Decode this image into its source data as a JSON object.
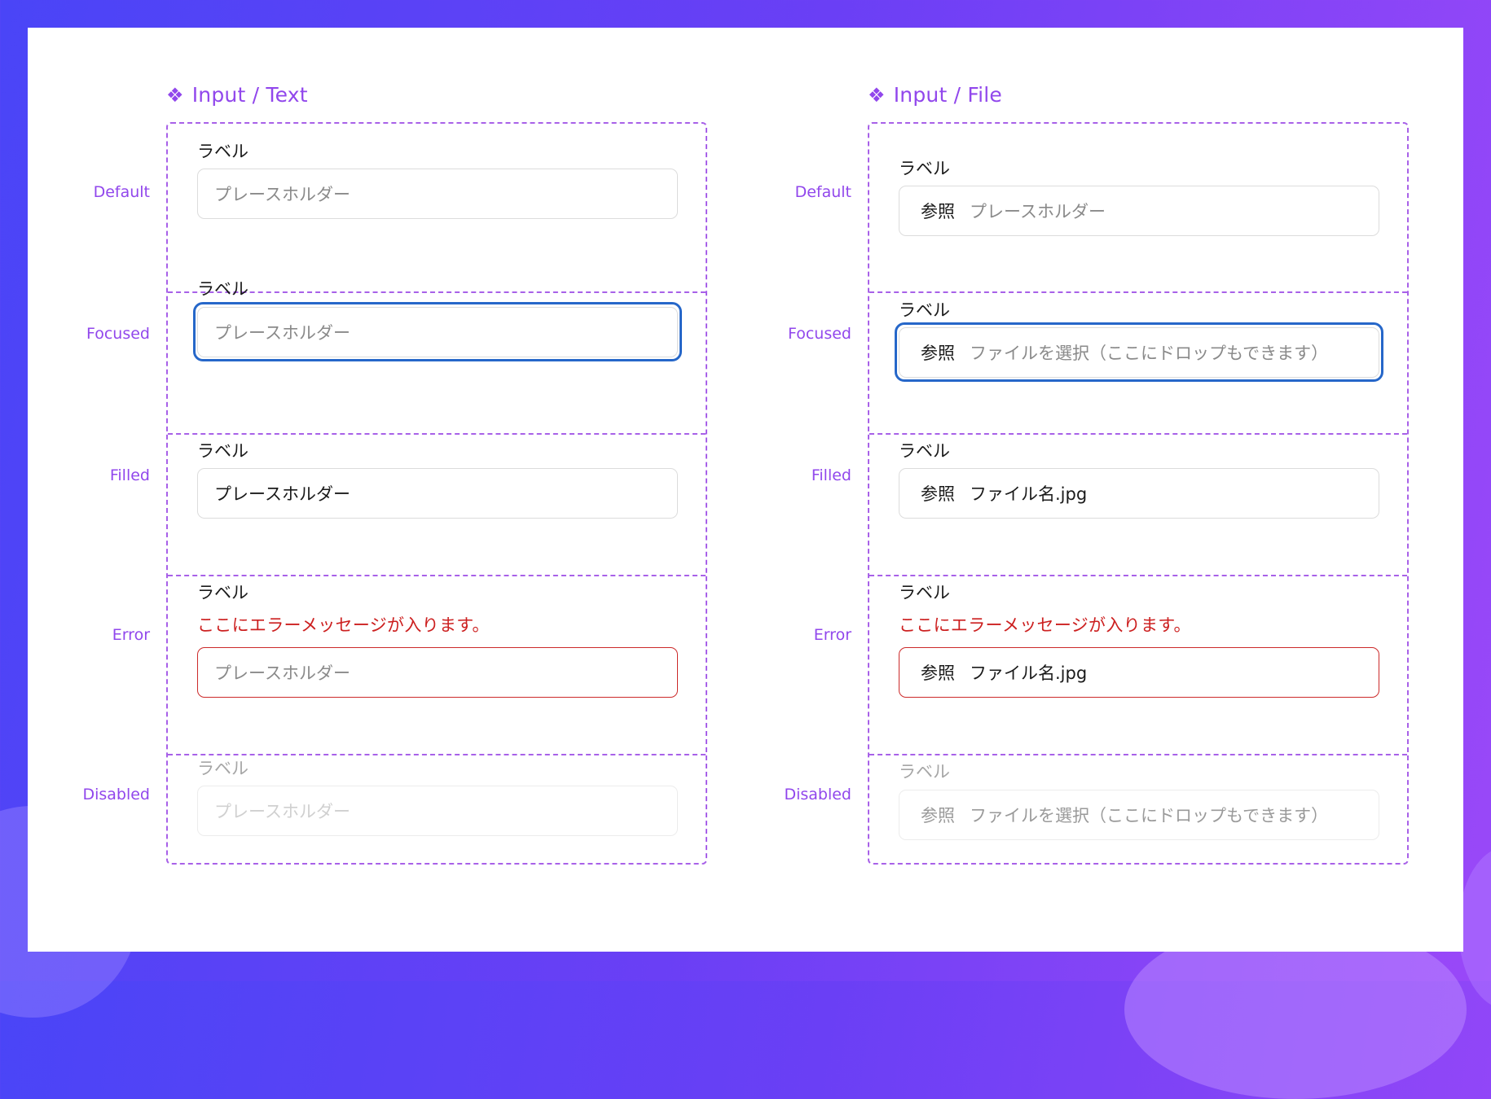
{
  "sections": {
    "text": {
      "title": "Input / Text",
      "icon": "component-icon",
      "states": {
        "default": {
          "state_label": "Default",
          "label": "ラベル",
          "placeholder": "プレースホルダー"
        },
        "focused": {
          "state_label": "Focused",
          "label": "ラベル",
          "placeholder": "プレースホルダー"
        },
        "filled": {
          "state_label": "Filled",
          "label": "ラベル",
          "value": "プレースホルダー"
        },
        "error": {
          "state_label": "Error",
          "label": "ラベル",
          "error_message": "ここにエラーメッセージが入ります。",
          "placeholder": "プレースホルダー"
        },
        "disabled": {
          "state_label": "Disabled",
          "label": "ラベル",
          "placeholder": "プレースホルダー"
        }
      }
    },
    "file": {
      "title": "Input / File",
      "icon": "component-icon",
      "states": {
        "default": {
          "state_label": "Default",
          "label": "ラベル",
          "browse": "参照",
          "text": "プレースホルダー"
        },
        "focused": {
          "state_label": "Focused",
          "label": "ラベル",
          "browse": "参照",
          "text": "ファイルを選択（ここにドロップもできます）"
        },
        "filled": {
          "state_label": "Filled",
          "label": "ラベル",
          "browse": "参照",
          "text": "ファイル名.jpg"
        },
        "error": {
          "state_label": "Error",
          "label": "ラベル",
          "error_message": "ここにエラーメッセージが入ります。",
          "browse": "参照",
          "text": "ファイル名.jpg"
        },
        "disabled": {
          "state_label": "Disabled",
          "label": "ラベル",
          "browse": "参照",
          "text": "ファイルを選択（ここにドロップもできます）"
        }
      }
    }
  },
  "colors": {
    "accent": "#9147ec",
    "focus": "#2667c9",
    "error": "#cc1f1f",
    "border": "#dcdcdc"
  }
}
